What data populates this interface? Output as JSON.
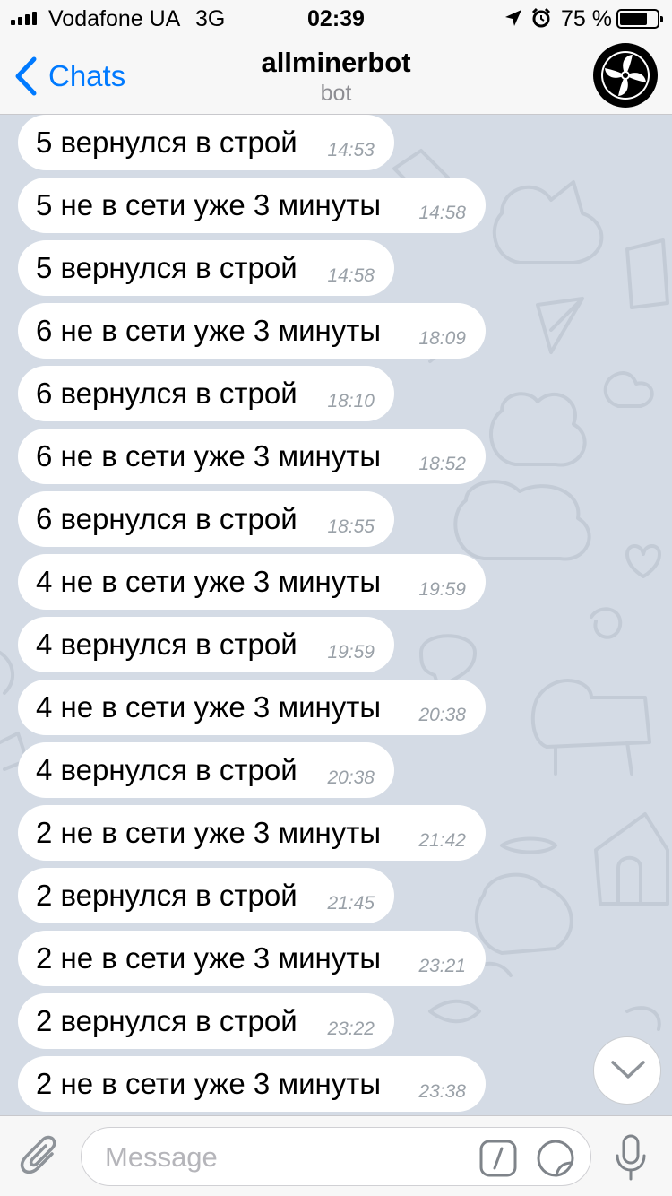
{
  "status_bar": {
    "carrier": "Vodafone UA",
    "network": "3G",
    "time": "02:39",
    "battery": "75 %",
    "battery_level": 0.75,
    "icons": [
      "signal-icon",
      "location-arrow-icon",
      "alarm-icon",
      "battery-icon"
    ]
  },
  "nav": {
    "back_label": "Chats",
    "title": "allminerbot",
    "subtitle": "bot",
    "icons": [
      "chevron-left-icon",
      "bot-avatar-fan-icon"
    ]
  },
  "messages": [
    {
      "text": "5 вернулся в строй",
      "time": "14:53"
    },
    {
      "text": "5 не в сети уже 3 минуты",
      "time": "14:58"
    },
    {
      "text": "5 вернулся в строй",
      "time": "14:58"
    },
    {
      "text": "6 не в сети уже 3 минуты",
      "time": "18:09"
    },
    {
      "text": "6 вернулся в строй",
      "time": "18:10"
    },
    {
      "text": "6 не в сети уже 3 минуты",
      "time": "18:52"
    },
    {
      "text": "6 вернулся в строй",
      "time": "18:55"
    },
    {
      "text": "4 не в сети уже 3 минуты",
      "time": "19:59"
    },
    {
      "text": "4 вернулся в строй",
      "time": "19:59"
    },
    {
      "text": "4 не в сети уже 3 минуты",
      "time": "20:38"
    },
    {
      "text": "4 вернулся в строй",
      "time": "20:38"
    },
    {
      "text": "2 не в сети уже 3 минуты",
      "time": "21:42"
    },
    {
      "text": "2 вернулся в строй",
      "time": "21:45"
    },
    {
      "text": "2 не в сети уже 3 минуты",
      "time": "23:21"
    },
    {
      "text": "2 вернулся в строй",
      "time": "23:22"
    },
    {
      "text": "2 не в сети уже 3 минуты",
      "time": "23:38"
    }
  ],
  "input": {
    "placeholder": "Message",
    "value": "",
    "icons": [
      "paperclip-icon",
      "bot-command-icon",
      "sticker-icon",
      "microphone-icon",
      "chevron-down-icon"
    ]
  },
  "colors": {
    "accent": "#007aff",
    "chat_background": "#d4dbe5",
    "bubble": "#ffffff",
    "time_text": "#9aa1a8"
  }
}
